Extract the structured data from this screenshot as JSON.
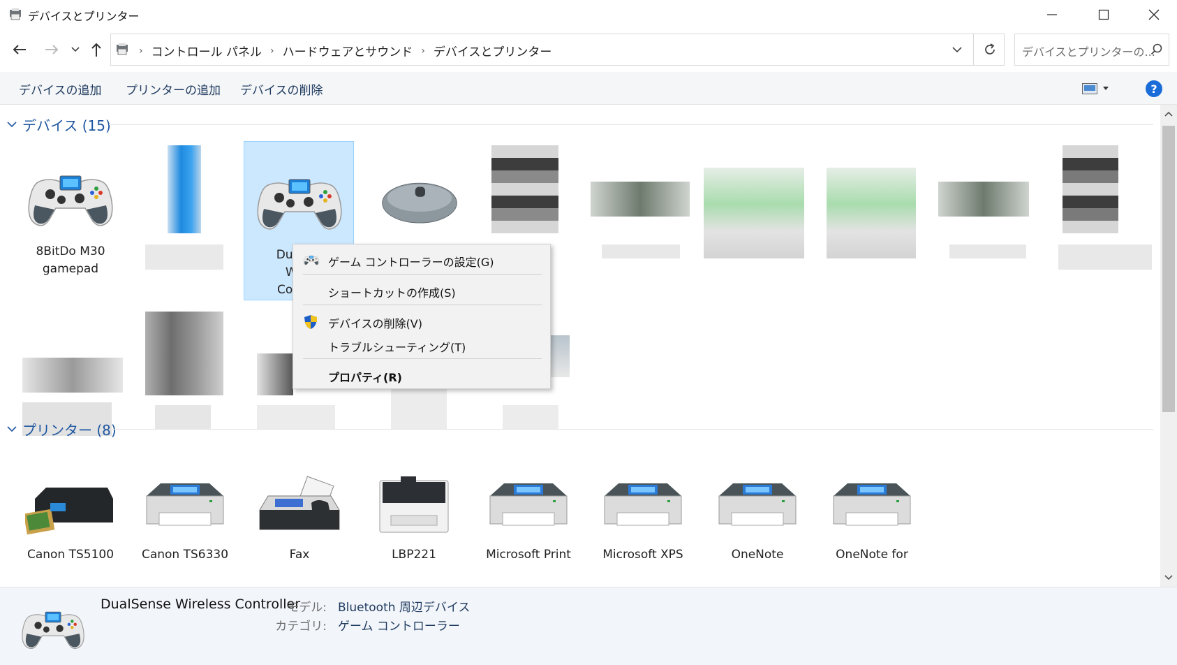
{
  "window": {
    "title": "デバイスとプリンター"
  },
  "nav": {
    "breadcrumb": [
      "コントロール パネル",
      "ハードウェアとサウンド",
      "デバイスとプリンター"
    ],
    "search_placeholder": "デバイスとプリンターの..."
  },
  "toolbar": {
    "add_device": "デバイスの追加",
    "add_printer": "プリンターの追加",
    "remove_device": "デバイスの削除",
    "help_label": "?"
  },
  "groups": {
    "devices": {
      "title": "デバイス (15)"
    },
    "printers": {
      "title": "プリンター (8)"
    }
  },
  "devices": [
    {
      "label_line1": "8BitDo M30",
      "label_line2": "gamepad",
      "icon": "gamepad-icon"
    },
    {
      "label_line1": "Dua",
      "label_line2": "Wi",
      "label_line3": "Con",
      "icon": "gamepad-icon",
      "selected": true
    },
    {
      "icon": "mouse-icon"
    }
  ],
  "printers": [
    {
      "label": "Canon TS5100",
      "icon": "inkjet-printer-icon"
    },
    {
      "label": "Canon TS6330",
      "icon": "printer-icon"
    },
    {
      "label": "Fax",
      "icon": "fax-icon"
    },
    {
      "label": "LBP221",
      "icon": "laser-printer-icon"
    },
    {
      "label": "Microsoft Print",
      "icon": "printer-icon"
    },
    {
      "label": "Microsoft XPS",
      "icon": "printer-icon"
    },
    {
      "label": "OneNote",
      "icon": "printer-icon"
    },
    {
      "label": "OneNote for",
      "icon": "printer-icon"
    }
  ],
  "context_menu": {
    "items": [
      {
        "label": "ゲーム コントローラーの設定(G)",
        "icon": "gamepad-icon"
      },
      {
        "label": "ショートカットの作成(S)"
      },
      {
        "label": "デバイスの削除(V)",
        "icon": "shield-icon"
      },
      {
        "label": "トラブルシューティング(T)"
      },
      {
        "label": "プロパティ(R)",
        "bold": true
      }
    ]
  },
  "details": {
    "name": "DualSense Wireless Controller",
    "model_label": "モデル:",
    "model_value": "Bluetooth 周辺デバイス",
    "category_label": "カテゴリ:",
    "category_value": "ゲーム コントローラー"
  },
  "colors": {
    "accent": "#1e56a0",
    "selection": "#cce8ff",
    "toolbar_bg": "#f5f6f7",
    "details_bg": "#f2f5fa",
    "help": "#1a6dd8"
  }
}
